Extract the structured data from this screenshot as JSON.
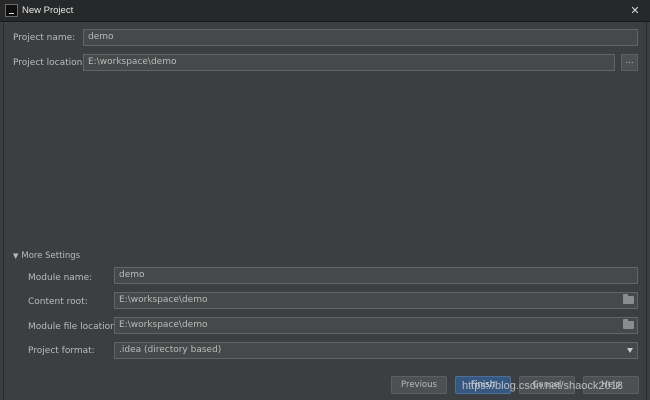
{
  "window": {
    "title": "New Project",
    "close_glyph": "✕"
  },
  "main": {
    "project_name_label": "Project name:",
    "project_name_value": "demo",
    "project_location_label": "Project location:",
    "project_location_value": "E:\\workspace\\demo",
    "browse_label": "..."
  },
  "more_settings": {
    "toggle_label": "More Settings",
    "toggle_glyph": "▼",
    "module_name_label": "Module name:",
    "module_name_value": "demo",
    "content_root_label": "Content root:",
    "content_root_value": "E:\\workspace\\demo",
    "module_file_location_label": "Module file location:",
    "module_file_location_value": "E:\\workspace\\demo",
    "project_format_label": "Project format:",
    "project_format_value": ".idea (directory based)"
  },
  "footer": {
    "previous_label": "Previous",
    "finish_label": "Finish",
    "cancel_label": "Cancel",
    "help_label": "Help"
  },
  "watermark": {
    "text": "https://blog.csdn.net/shaock2018"
  },
  "colors": {
    "background": "#3c3f41",
    "field_bg": "#45494a",
    "primary_button": "#365880"
  },
  "icons": [
    "app-icon",
    "close-icon",
    "folder-icon",
    "chevron-down-icon",
    "triangle-down-icon"
  ]
}
